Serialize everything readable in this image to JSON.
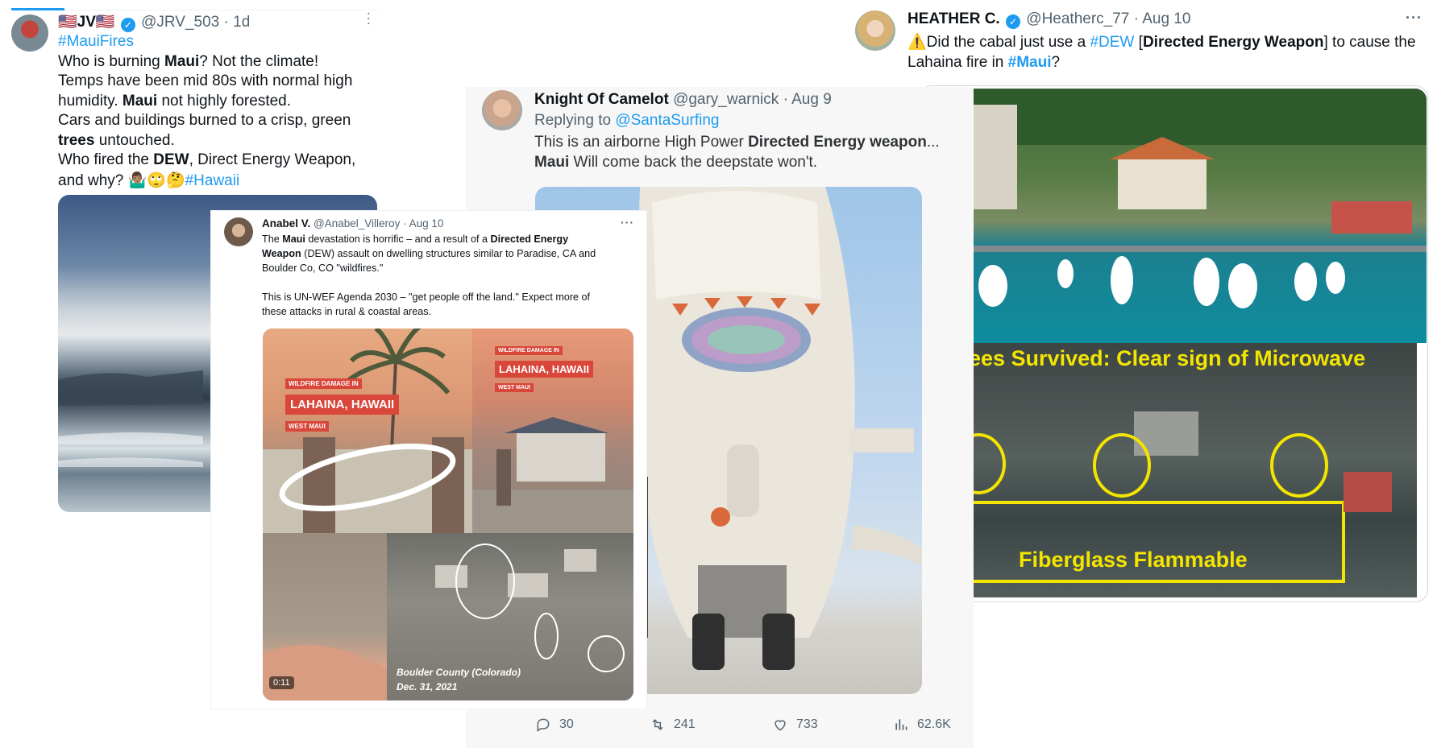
{
  "tweet_jrv": {
    "name": "🇺🇸JV🇺🇸",
    "handle": "@JRV_503",
    "time": "· 1d",
    "more": "···",
    "text": {
      "tag1": "#MauiFires",
      "l1a": "Who is burning ",
      "l1b": "Maui",
      "l1c": "? Not the climate!",
      "l2": "Temps have been mid 80s with normal high",
      "l3a": "humidity. ",
      "l3b": "Maui",
      "l3c": " not highly forested.",
      "l4": "Cars and buildings burned to a crisp, green",
      "l5a": "trees",
      "l5b": " untouched.",
      "l6a": "Who fired the ",
      "l6b": "DEW",
      "l6c": ", Direct Energy Weapon,",
      "l7a": "and why? ",
      "l7emoji": "🤷🏽‍♂️🙄🤔",
      "l7tag": "#Hawaii"
    }
  },
  "tweet_anabel": {
    "name": "Anabel V.",
    "handle": "@Anabel_Villeroy",
    "time": "· Aug 10",
    "more": "···",
    "text": {
      "p1a": "The ",
      "p1b": "Maui",
      "p1c": " devastation is horrific – and a result of a ",
      "p1d": "Directed Energy",
      "p2a": "Weapon",
      "p2b": " (DEW) assault on dwelling structures similar to Paradise, CA and",
      "p3": "Boulder Co, CO \"wildfires.\"",
      "p4": "This is UN-WEF Agenda 2030 – \"get people off the land.\" Expect more of",
      "p5": "these attacks in rural & coastal areas."
    },
    "media": {
      "label1_top": "WILDFIRE DAMAGE IN",
      "label1_main": "LAHAINA, HAWAII",
      "label1_sub": "WEST MAUI",
      "label2_top": "WILDFIRE DAMAGE IN",
      "label2_main": "LAHAINA, HAWAII",
      "label2_sub": "WEST MAUI",
      "caption_place": "Boulder County (Colorado)",
      "caption_date": "Dec. 31, 2021",
      "duration": "0:11"
    }
  },
  "tweet_knight": {
    "name": "Knight Of Camelot",
    "handle": "@gary_warnick",
    "time": "· Aug 9",
    "replying_label": "Replying to ",
    "replying_handle": "@SantaSurfing",
    "text": {
      "l1a": "This is an airborne High Power ",
      "l1b": "Directed Energy weapon",
      "l1c": "...",
      "l2a": "Maui",
      "l2b": " Will come back the deepstate won't."
    },
    "stats": {
      "replies": "30",
      "retweets": "241",
      "likes": "733",
      "views": "62.6K"
    }
  },
  "tweet_heather": {
    "name": "HEATHER C.",
    "handle": "@Heatherc_77",
    "time": "· Aug 10",
    "more": "···",
    "text": {
      "warn": "⚠️",
      "l1a": "Did the cabal just use a ",
      "l1tag": "#DEW",
      "l1b": " [",
      "l1c": "Directed Energy Weapon",
      "l1d": "] to cause the",
      "l2a": "Lahaina fire in ",
      "l2tag": "#Maui",
      "l2b": "?"
    },
    "media": {
      "banner": "ees Survived: Clear sign of Microwave",
      "box_label": "Fiberglass Flammable"
    }
  },
  "colors": {
    "link": "#1d9bf0",
    "text": "#0f1419",
    "muted": "#536471",
    "highlight_yellow": "#f3e500"
  },
  "icons": [
    "verified-badge-icon",
    "more-options-icon",
    "reply-icon",
    "retweet-icon",
    "like-icon",
    "views-icon"
  ]
}
